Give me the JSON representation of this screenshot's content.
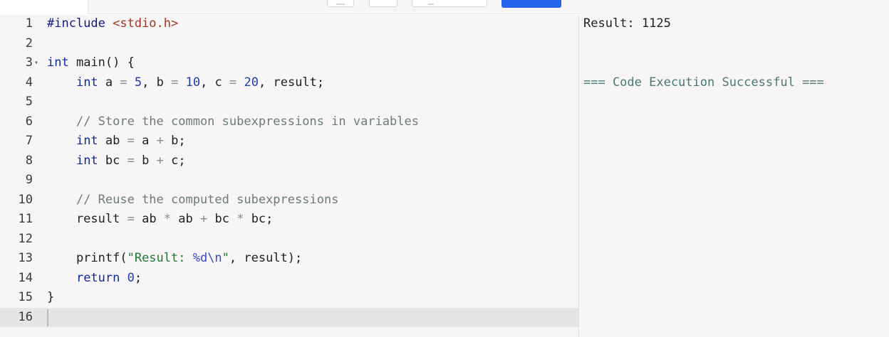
{
  "editor": {
    "lines": [
      {
        "n": "1",
        "tokens": [
          [
            "pp",
            "#include "
          ],
          [
            "hdr",
            "<stdio.h>"
          ]
        ]
      },
      {
        "n": "2",
        "tokens": []
      },
      {
        "n": "3",
        "fold": true,
        "tokens": [
          [
            "kw",
            "int"
          ],
          [
            "",
            " main() {"
          ]
        ]
      },
      {
        "n": "4",
        "tokens": [
          [
            "",
            "    "
          ],
          [
            "kw",
            "int"
          ],
          [
            "",
            " a "
          ],
          [
            "op",
            "="
          ],
          [
            "",
            " "
          ],
          [
            "num",
            "5"
          ],
          [
            "",
            ", b "
          ],
          [
            "op",
            "="
          ],
          [
            "",
            " "
          ],
          [
            "num",
            "10"
          ],
          [
            "",
            ", c "
          ],
          [
            "op",
            "="
          ],
          [
            "",
            " "
          ],
          [
            "num",
            "20"
          ],
          [
            "",
            ", result;"
          ]
        ]
      },
      {
        "n": "5",
        "tokens": []
      },
      {
        "n": "6",
        "tokens": [
          [
            "",
            "    "
          ],
          [
            "cm",
            "// Store the common subexpressions in variables"
          ]
        ]
      },
      {
        "n": "7",
        "tokens": [
          [
            "",
            "    "
          ],
          [
            "kw",
            "int"
          ],
          [
            "",
            " ab "
          ],
          [
            "op",
            "="
          ],
          [
            "",
            " a "
          ],
          [
            "op",
            "+"
          ],
          [
            "",
            " b;"
          ]
        ]
      },
      {
        "n": "8",
        "tokens": [
          [
            "",
            "    "
          ],
          [
            "kw",
            "int"
          ],
          [
            "",
            " bc "
          ],
          [
            "op",
            "="
          ],
          [
            "",
            " b "
          ],
          [
            "op",
            "+"
          ],
          [
            "",
            " c;"
          ]
        ]
      },
      {
        "n": "9",
        "tokens": []
      },
      {
        "n": "10",
        "tokens": [
          [
            "",
            "    "
          ],
          [
            "cm",
            "// Reuse the computed subexpressions"
          ]
        ]
      },
      {
        "n": "11",
        "tokens": [
          [
            "",
            "    result "
          ],
          [
            "op",
            "="
          ],
          [
            "",
            " ab "
          ],
          [
            "op",
            "*"
          ],
          [
            "",
            " ab "
          ],
          [
            "op",
            "+"
          ],
          [
            "",
            " bc "
          ],
          [
            "op",
            "*"
          ],
          [
            "",
            " bc;"
          ]
        ]
      },
      {
        "n": "12",
        "tokens": []
      },
      {
        "n": "13",
        "tokens": [
          [
            "",
            "    printf("
          ],
          [
            "str",
            "\"Result: "
          ],
          [
            "esc",
            "%d\\n"
          ],
          [
            "str",
            "\""
          ],
          [
            "",
            ", result);"
          ]
        ]
      },
      {
        "n": "14",
        "tokens": [
          [
            "",
            "    "
          ],
          [
            "kw",
            "return"
          ],
          [
            "",
            " "
          ],
          [
            "num",
            "0"
          ],
          [
            "",
            ";"
          ]
        ]
      },
      {
        "n": "15",
        "tokens": [
          [
            "",
            "}"
          ]
        ]
      },
      {
        "n": "16",
        "active": true,
        "tokens": []
      }
    ]
  },
  "output": {
    "result_line": "Result: 1125",
    "success_line": "=== Code Execution Successful ==="
  },
  "colors": {
    "run_button": "#2563eb",
    "keyword": "#0d2a9c",
    "string": "#1f7a2e",
    "comment": "#6b7d74",
    "success": "#4a7a72"
  }
}
